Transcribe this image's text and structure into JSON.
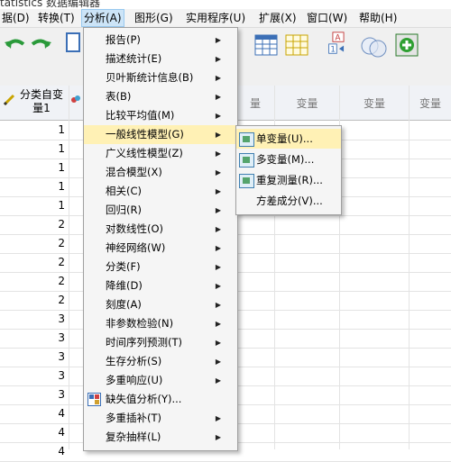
{
  "window": {
    "title": "tatistics 数据编辑器"
  },
  "menubar": {
    "items": [
      {
        "label": "据(D)"
      },
      {
        "label": "转换(T)"
      },
      {
        "label": "分析(A)"
      },
      {
        "label": "图形(G)"
      },
      {
        "label": "实用程序(U)"
      },
      {
        "label": "扩展(X)"
      },
      {
        "label": "窗口(W)"
      },
      {
        "label": "帮助(H)"
      }
    ]
  },
  "grid": {
    "first_column_header": "分类自变量1",
    "column_headers": [
      "量",
      "变量",
      "变量",
      "变量"
    ],
    "first_column_values": [
      1,
      1,
      1,
      1,
      1,
      2,
      2,
      2,
      2,
      2,
      3,
      3,
      3,
      3,
      3,
      4,
      4,
      4
    ]
  },
  "analyze_menu": {
    "items": [
      {
        "label": "报告(P)",
        "submenu": true
      },
      {
        "label": "描述统计(E)",
        "submenu": true
      },
      {
        "label": "贝叶斯统计信息(B)",
        "submenu": true
      },
      {
        "label": "表(B)",
        "submenu": true
      },
      {
        "label": "比较平均值(M)",
        "submenu": true
      },
      {
        "label": "一般线性模型(G)",
        "submenu": true,
        "highlighted": true
      },
      {
        "label": "广义线性模型(Z)",
        "submenu": true
      },
      {
        "label": "混合模型(X)",
        "submenu": true
      },
      {
        "label": "相关(C)",
        "submenu": true
      },
      {
        "label": "回归(R)",
        "submenu": true
      },
      {
        "label": "对数线性(O)",
        "submenu": true
      },
      {
        "label": "神经网络(W)",
        "submenu": true
      },
      {
        "label": "分类(F)",
        "submenu": true
      },
      {
        "label": "降维(D)",
        "submenu": true
      },
      {
        "label": "刻度(A)",
        "submenu": true
      },
      {
        "label": "非参数检验(N)",
        "submenu": true
      },
      {
        "label": "时间序列预测(T)",
        "submenu": true
      },
      {
        "label": "生存分析(S)",
        "submenu": true
      },
      {
        "label": "多重响应(U)",
        "submenu": true
      },
      {
        "label": "缺失值分析(Y)...",
        "submenu": false,
        "icon": "missing-value-icon"
      },
      {
        "label": "多重插补(T)",
        "submenu": true
      },
      {
        "label": "复杂抽样(L)",
        "submenu": true
      }
    ]
  },
  "glm_submenu": {
    "items": [
      {
        "label": "单变量(U)...",
        "icon": "univariate-icon",
        "highlighted": true
      },
      {
        "label": "多变量(M)...",
        "icon": "multivariate-icon"
      },
      {
        "label": "重复测量(R)...",
        "icon": "repeated-measures-icon"
      },
      {
        "label": "方差成分(V)..."
      }
    ]
  },
  "colors": {
    "highlight": "#fff1b5",
    "menu_active": "#cce4f7",
    "menu_bg": "#f5f5f5"
  }
}
